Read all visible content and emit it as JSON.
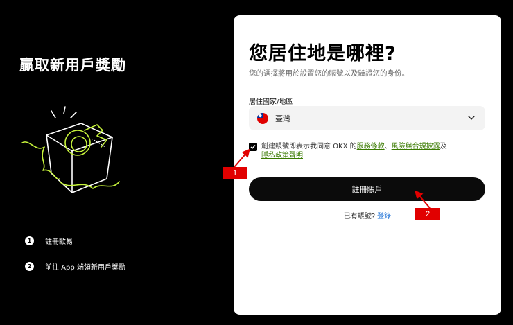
{
  "left": {
    "title": "贏取新用戶獎勵",
    "steps": [
      {
        "num": "1",
        "label": "註冊歐易"
      },
      {
        "num": "2",
        "label": "前往 App 端領新用戶獎勵"
      }
    ]
  },
  "card": {
    "title": "您居住地是哪裡?",
    "subtitle": "您的選擇將用於設置您的賬號以及驗證您的身份。",
    "country_label": "居住國家/地區",
    "country_value": "臺灣",
    "agreement": {
      "prefix": "創建賬號即表示我同意 OKX 的",
      "terms": "服務條款",
      "sep": "、",
      "risk": "風險與合規披露",
      "and": "及",
      "privacy": "隱私政策聲明"
    },
    "register_button": "註冊賬戶",
    "login_prompt": "已有賬號?",
    "login_link": "登錄"
  },
  "annotations": {
    "marker1": "1",
    "marker2": "2",
    "color": "#e10000"
  },
  "colors": {
    "accent_green": "#c8f53b",
    "link_green": "#3a7a00",
    "link_blue": "#1a6fd6"
  }
}
